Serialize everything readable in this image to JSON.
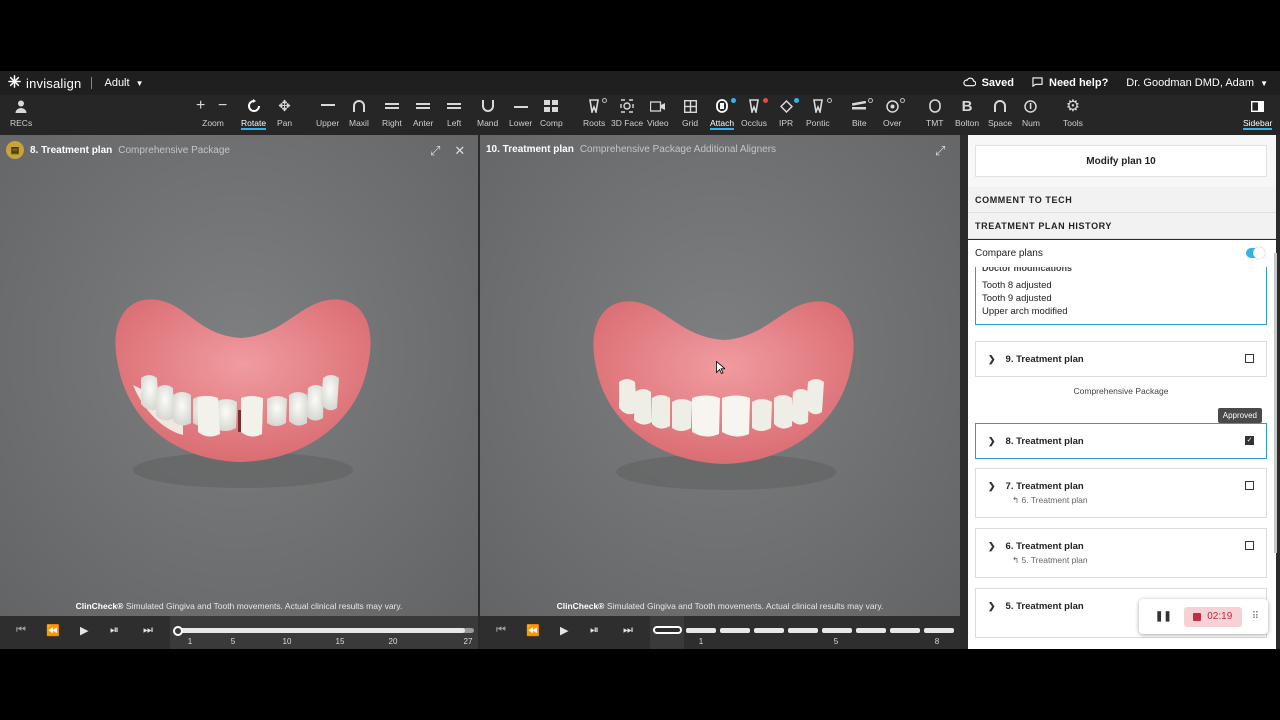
{
  "topbar": {
    "brand": "invisalign",
    "mode": "Adult",
    "saved": "Saved",
    "help": "Need help?",
    "user": "Dr. Goodman DMD, Adam"
  },
  "toolbar": {
    "recs": "RECs",
    "zoom": "Zoom",
    "rotate": "Rotate",
    "pan": "Pan",
    "upper": "Upper",
    "maxil": "Maxil",
    "right": "Right",
    "anter": "Anter",
    "left": "Left",
    "mand": "Mand",
    "lower": "Lower",
    "comp": "Comp",
    "roots": "Roots",
    "face3d": "3D Face",
    "video": "Video",
    "grid": "Grid",
    "attach": "Attach",
    "occlus": "Occlus",
    "ipr": "IPR",
    "pontic": "Pontic",
    "bite": "Bite",
    "over": "Over",
    "tmt": "TMT",
    "bolton": "Bolton",
    "space": "Space",
    "num": "Num",
    "tools": "Tools",
    "sidebar": "Sidebar"
  },
  "left_view": {
    "title": "8. Treatment plan",
    "subtitle": "Comprehensive Package",
    "disclaimer_brand": "ClinCheck®",
    "disclaimer": "Simulated Gingiva and Tooth movements. Actual clinical results may vary.",
    "timeline_ticks": [
      "1",
      "5",
      "10",
      "15",
      "20",
      "27"
    ],
    "progress": 0.97
  },
  "right_view": {
    "title": "10. Treatment plan",
    "subtitle": "Comprehensive Package Additional Aligners",
    "disclaimer_brand": "ClinCheck®",
    "disclaimer": "Simulated Gingiva and Tooth movements. Actual clinical results may vary.",
    "timeline_ticks": [
      "1",
      "5",
      "8"
    ]
  },
  "sidebar": {
    "modify_button": "Modify plan 10",
    "comment_to_tech": "COMMENT TO TECH",
    "history_title": "TREATMENT PLAN HISTORY",
    "compare_plans": "Compare plans",
    "mod_header": "Doctor modifications",
    "mod_lines": [
      "Tooth 8 adjusted",
      "Tooth 9 adjusted",
      "Upper arch modified"
    ],
    "package": "Comprehensive Package",
    "approved": "Approved",
    "plans": [
      {
        "title": "9. Treatment plan",
        "sub": ""
      },
      {
        "title": "8. Treatment plan",
        "sub": ""
      },
      {
        "title": "7. Treatment plan",
        "sub": "6. Treatment plan"
      },
      {
        "title": "6. Treatment plan",
        "sub": "5. Treatment plan"
      },
      {
        "title": "5. Treatment plan",
        "sub": ""
      }
    ]
  },
  "recorder": {
    "time": "02:19"
  },
  "colors": {
    "accent": "#30b4e8",
    "selection_border": "#2f9fbf",
    "gum": "#e58a8f",
    "record": "#c0303f"
  }
}
